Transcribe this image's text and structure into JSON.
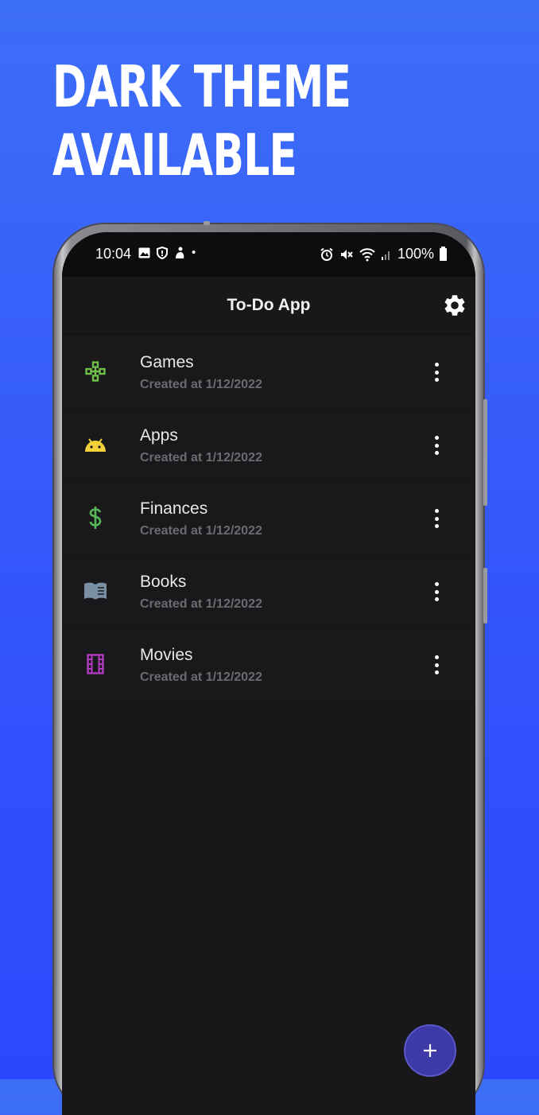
{
  "headline": {
    "line1": "DARK THEME",
    "line2": "AVAILABLE"
  },
  "status_bar": {
    "time": "10:04",
    "battery": "100%",
    "dot": "•"
  },
  "app": {
    "title": "To-Do App",
    "settings_icon": "gear-icon"
  },
  "lists": [
    {
      "title": "Games",
      "subtitle": "Created at 1/12/2022",
      "icon": "gamepad-icon",
      "color": "#6fbf4a"
    },
    {
      "title": "Apps",
      "subtitle": "Created at 1/12/2022",
      "icon": "android-icon",
      "color": "#f2d13a"
    },
    {
      "title": "Finances",
      "subtitle": "Created at 1/12/2022",
      "icon": "dollar-icon",
      "color": "#56b65a"
    },
    {
      "title": "Books",
      "subtitle": "Created at 1/12/2022",
      "icon": "book-icon",
      "color": "#7a8fa3"
    },
    {
      "title": "Movies",
      "subtitle": "Created at 1/12/2022",
      "icon": "film-icon",
      "color": "#b23bbf"
    }
  ],
  "fab": {
    "label": "+",
    "icon": "add-icon",
    "color": "#3d3aa8"
  },
  "colors": {
    "background": "#3355fb",
    "surface": "#19191c",
    "text_primary": "#e8e8e8",
    "text_secondary": "#6b6b70"
  }
}
